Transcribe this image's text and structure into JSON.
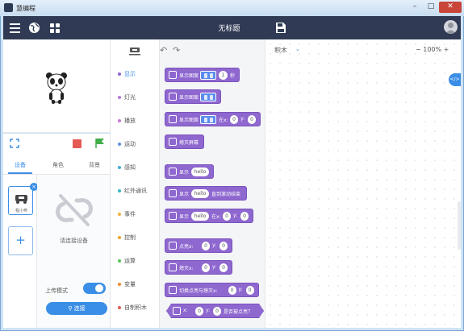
{
  "window": {
    "title": "慧编程",
    "min_icon": "window-minimize-icon",
    "max_icon": "window-maximize-icon",
    "close_icon": "window-close-icon"
  },
  "header": {
    "title": "无标题",
    "menu_icon": "hamburger-menu-icon",
    "globe_icon": "globe-icon",
    "grid_icon": "grid-icon",
    "save_icon": "save-icon",
    "avatar_icon": "user-avatar-icon",
    "bg_color": "#303a54"
  },
  "stage": {
    "sprite": "panda-icon",
    "fullscreen_icon": "fullscreen-icon",
    "stop_icon": "stop-icon",
    "stop_color": "#e55a55",
    "go_icon": "green-flag-icon",
    "go_color": "#3fae49"
  },
  "left_tabs": [
    "设备",
    "角色",
    "背景"
  ],
  "device": {
    "label": "程小奔",
    "badge": "×",
    "add_label": "+",
    "hint": "请连接设备",
    "upload_mode": "上传模式",
    "upload_on": true,
    "connect_label": "连接"
  },
  "categories": [
    {
      "label": "显示",
      "color": "#8e67cf",
      "active": true
    },
    {
      "label": "灯光",
      "color": "#b37bd9"
    },
    {
      "label": "播放",
      "color": "#c678d6"
    },
    {
      "label": "运动",
      "color": "#5f8fd9"
    },
    {
      "label": "感知",
      "color": "#4aa8dd"
    },
    {
      "label": "红外通讯",
      "color": "#39b7c6"
    },
    {
      "label": "事件",
      "color": "#f2b23a"
    },
    {
      "label": "控制",
      "color": "#f2a12e"
    },
    {
      "label": "运算",
      "color": "#58c25c"
    },
    {
      "label": "变量",
      "color": "#f28c2e"
    },
    {
      "label": "自制积木",
      "color": "#e55a55"
    }
  ],
  "palette": {
    "undo_icon": "undo-icon",
    "redo_icon": "redo-icon",
    "blocks": [
      {
        "text": "显示图案",
        "value": "1",
        "suffix": "秒"
      },
      {
        "text": "显示图案"
      },
      {
        "text": "显示图案",
        "mid": "在x:",
        "x": "0",
        "ylabel": "y:",
        "y": "0"
      },
      {
        "text": "熄灭屏幕"
      },
      {
        "text": "显示",
        "value": "hello"
      },
      {
        "text": "显示",
        "value": "hello",
        "suffix": "直到滚动结束"
      },
      {
        "text": "显示",
        "value": "hello",
        "mid": "在x:",
        "x": "0",
        "ylabel": "y:",
        "y": "0"
      },
      {
        "text": "点亮x:",
        "x": "0",
        "ylabel": "y:",
        "y": "0"
      },
      {
        "text": "熄灭x:",
        "x": "0",
        "ylabel": "y:",
        "y": "0"
      },
      {
        "text": "切换点亮与熄灭x:",
        "x": "0",
        "ylabel": "y:",
        "y": "0"
      },
      {
        "text": "x:",
        "x": "0",
        "ylabel": "y:",
        "y": "0",
        "suffix": "是否被点亮？"
      }
    ]
  },
  "workspace": {
    "title": "积木",
    "zoom_out": "−",
    "zoom": "100%",
    "zoom_in": "+",
    "code_icon": "</>"
  }
}
